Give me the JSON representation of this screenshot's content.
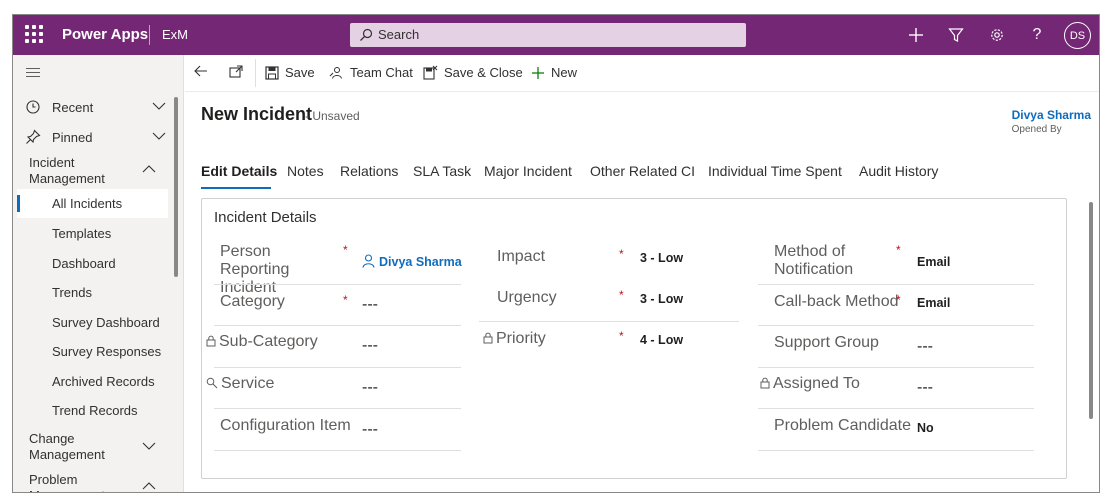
{
  "topbar": {
    "app_title": "Power Apps",
    "environment": "ExM",
    "search_placeholder": "Search",
    "avatar_initials": "DS"
  },
  "sidebar": {
    "recent": "Recent",
    "pinned": "Pinned",
    "groups": [
      {
        "label": "Incident Management",
        "expanded": true
      },
      {
        "label": "Change Management",
        "expanded": false
      },
      {
        "label": "Problem Management",
        "expanded": true
      }
    ],
    "items": [
      "All Incidents",
      "Templates",
      "Dashboard",
      "Trends",
      "Survey Dashboard",
      "Survey Responses",
      "Archived Records",
      "Trend Records"
    ],
    "active_item": "All Incidents"
  },
  "commandbar": {
    "save": "Save",
    "team_chat": "Team Chat",
    "save_close": "Save & Close",
    "new": "New"
  },
  "header": {
    "title": "New Incident",
    "status": "- Unsaved",
    "owner_name": "Divya Sharma",
    "owner_role": "Opened By"
  },
  "tabs": [
    "Edit Details",
    "Notes",
    "Relations",
    "SLA Task",
    "Major Incident",
    "Other Related CI",
    "Individual Time Spent",
    "Audit History"
  ],
  "section": {
    "title": "Incident Details",
    "col1": {
      "person_label": "Person Reporting Incident",
      "person_value": "Divya Sharma",
      "category_label": "Category",
      "category_value": "---",
      "subcategory_label": "Sub-Category",
      "subcategory_value": "---",
      "service_label": "Service",
      "service_value": "---",
      "ci_label": "Configuration Item",
      "ci_value": "---"
    },
    "col2": {
      "impact_label": "Impact",
      "impact_value": "3 - Low",
      "urgency_label": "Urgency",
      "urgency_value": "3 - Low",
      "priority_label": "Priority",
      "priority_value": "4 - Low"
    },
    "col3": {
      "method_label": "Method of Notification",
      "method_value": "Email",
      "callback_label": "Call-back Method",
      "callback_value": "Email",
      "support_label": "Support Group",
      "support_value": "---",
      "assigned_label": "Assigned To",
      "assigned_value": "---",
      "problem_label": "Problem Candidate",
      "problem_value": "No"
    }
  },
  "required_mark": "*",
  "colors": {
    "brand": "#742774",
    "accent": "#0f6cbd",
    "required": "#c50f1f"
  }
}
